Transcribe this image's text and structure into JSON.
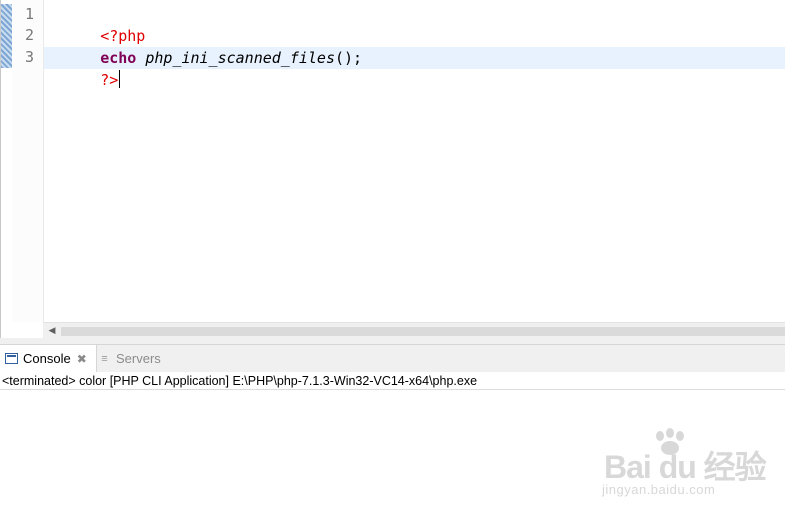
{
  "editor": {
    "line_numbers": [
      "1",
      "2",
      "3"
    ],
    "lines": [
      [
        {
          "text": "<?php",
          "kind": "tag"
        }
      ],
      [
        {
          "text": "echo",
          "kind": "keyword"
        },
        {
          "text": " ",
          "kind": "punct"
        },
        {
          "text": "php_ini_scanned_files",
          "kind": "func"
        },
        {
          "text": "();",
          "kind": "punct"
        }
      ],
      [
        {
          "text": "?>",
          "kind": "tag"
        }
      ]
    ],
    "colors": {
      "tag": "#e00000",
      "keyword": "#7f0055",
      "current_line": "#e8f2fe"
    }
  },
  "scrollbar": {
    "left_arrow_icon": "chevron-left-icon"
  },
  "console_view": {
    "tabs": [
      {
        "label": "Console",
        "icon": "console-icon",
        "active": true,
        "closable": true
      },
      {
        "label": "Servers",
        "icon": "servers-icon",
        "active": false,
        "closable": false
      }
    ],
    "status": "<terminated> color [PHP CLI Application] E:\\PHP\\php-7.1.3-Win32-VC14-x64\\php.exe"
  },
  "watermark": {
    "main": "Bai du 经验",
    "url": "jingyan.baidu.com"
  }
}
